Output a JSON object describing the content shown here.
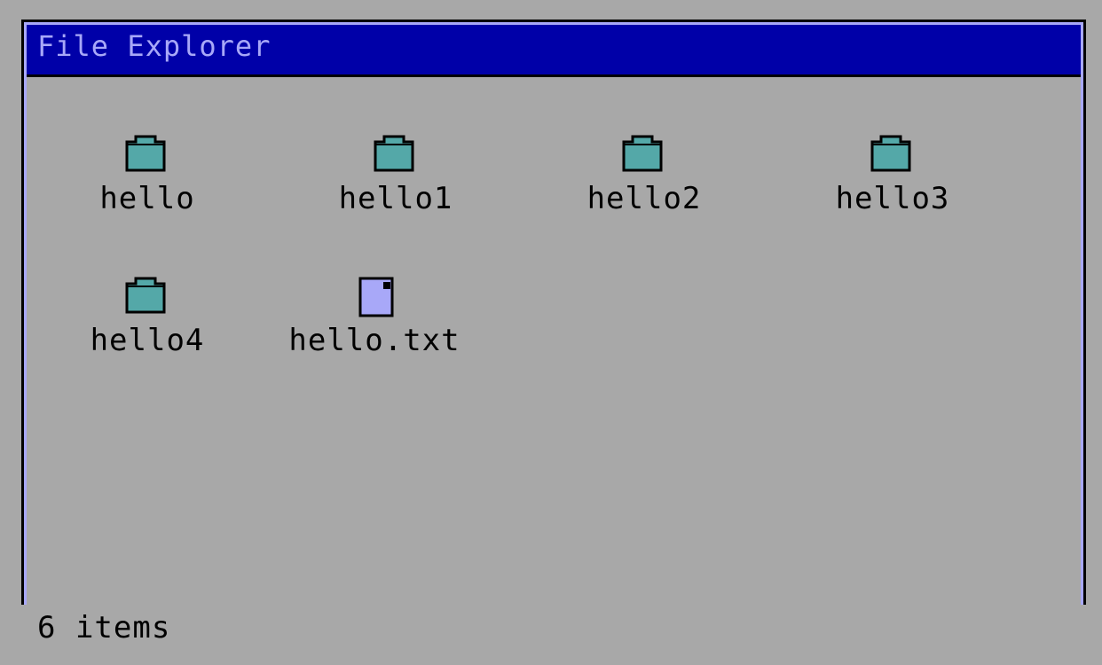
{
  "window": {
    "title": "File Explorer"
  },
  "items": [
    {
      "name": "hello",
      "type": "folder",
      "icon": "folder-icon"
    },
    {
      "name": "hello1",
      "type": "folder",
      "icon": "folder-icon"
    },
    {
      "name": "hello2",
      "type": "folder",
      "icon": "folder-icon"
    },
    {
      "name": "hello3",
      "type": "folder",
      "icon": "folder-icon"
    },
    {
      "name": "hello4",
      "type": "folder",
      "icon": "folder-icon"
    },
    {
      "name": "hello.txt",
      "type": "file",
      "icon": "text-file-icon"
    }
  ],
  "status": {
    "text": "6 items"
  },
  "colors": {
    "titlebar": "#0000a8",
    "title_text": "#a8a8f8",
    "background": "#a8a8a8",
    "folder": "#54a8a8",
    "file": "#a8a8f8"
  }
}
